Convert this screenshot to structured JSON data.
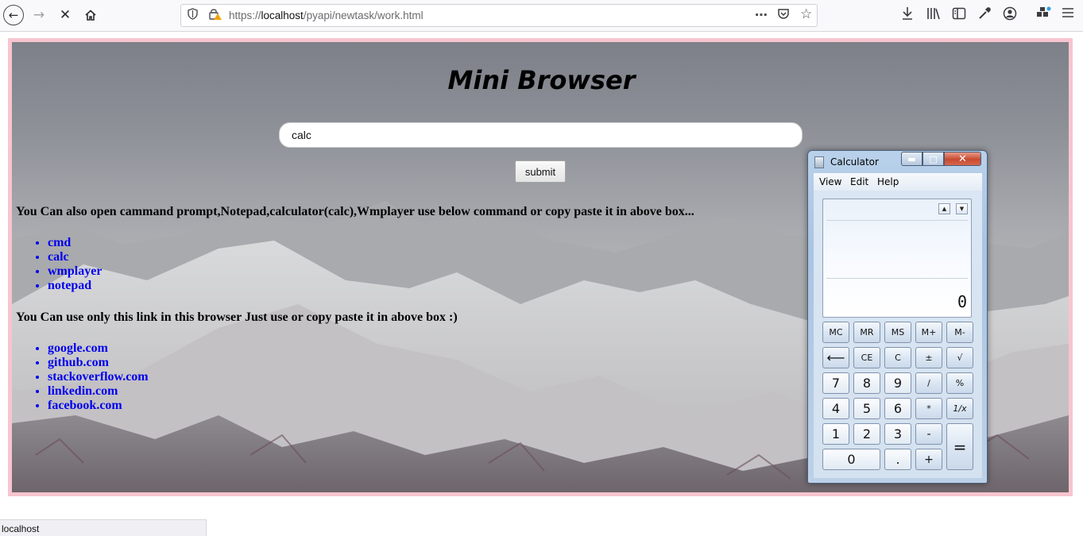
{
  "browser": {
    "back_icon": "arrow-left-icon",
    "forward_icon": "arrow-right-icon",
    "stop_icon": "close-icon",
    "home_icon": "home-icon",
    "url_prefix": "https://",
    "url_host": "localhost",
    "url_path": "/pyapi/newtask/work.html",
    "status_text": "localhost"
  },
  "page": {
    "title": "Mini Browser",
    "search_value": "calc",
    "submit_label": "submit",
    "apps_intro": "You Can also open cammand prompt,Notepad,calculator(calc),Wmplayer use below command or copy paste it in above box...",
    "apps": [
      "cmd",
      "calc",
      "wmplayer",
      "notepad"
    ],
    "links_intro": "You Can use only this link in this browser Just use or copy paste it in above box :)",
    "links": [
      "google.com",
      "github.com",
      "stackoverflow.com",
      "linkedin.com",
      "facebook.com"
    ],
    "frame_color": "#f7c5cf",
    "link_color": "#0000ee"
  },
  "calculator": {
    "title": "Calculator",
    "menu": [
      "View",
      "Edit",
      "Help"
    ],
    "display_value": "0",
    "memory_keys": [
      "MC",
      "MR",
      "MS",
      "M+",
      "M-"
    ],
    "row2_keys": [
      "⟵",
      "CE",
      "C",
      "±",
      "√"
    ],
    "row3_keys": [
      "7",
      "8",
      "9",
      "/",
      "%"
    ],
    "row4_keys": [
      "4",
      "5",
      "6",
      "*",
      "1/x"
    ],
    "row5_keys": [
      "1",
      "2",
      "3",
      "-",
      "="
    ],
    "row6_keys": [
      "0",
      ".",
      "+"
    ]
  }
}
